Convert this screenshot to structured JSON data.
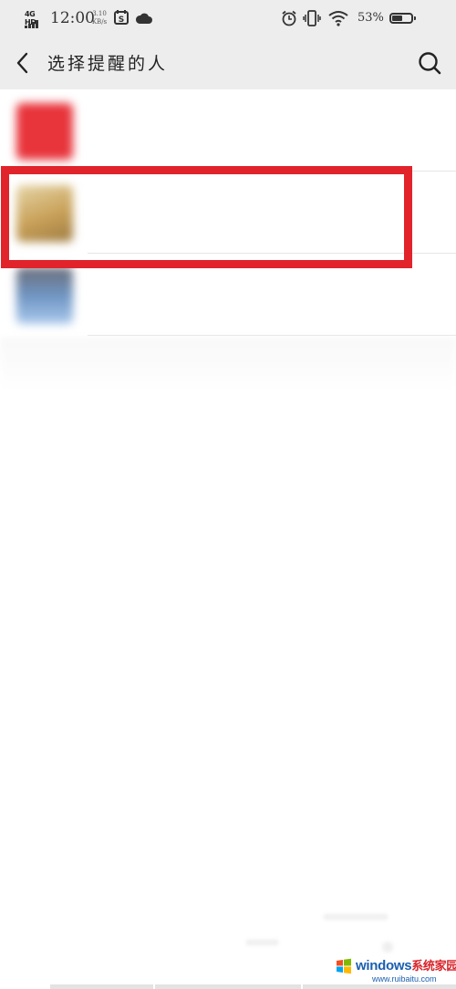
{
  "status_bar": {
    "network": "4G HD",
    "time": "12:00",
    "speed_value": "3.10",
    "speed_unit": "KB/s",
    "battery_percent": "53%",
    "battery_level": 0.53
  },
  "header": {
    "title": "选择提醒的人",
    "back_icon": "chevron-left-icon",
    "search_icon": "search-icon"
  },
  "contacts": [
    {
      "name": "",
      "avatar_color": "#e8343b"
    },
    {
      "name": "",
      "avatar_color": "#c9a25a",
      "highlighted": true
    },
    {
      "name": "",
      "avatar_color": "#6f95c3"
    }
  ],
  "colors": {
    "bar_background": "#ededed",
    "highlight": "#e1232b"
  },
  "watermark": {
    "brand": "windows",
    "brand_cn": "系统家园",
    "url": "www.ruibaitu.com"
  }
}
